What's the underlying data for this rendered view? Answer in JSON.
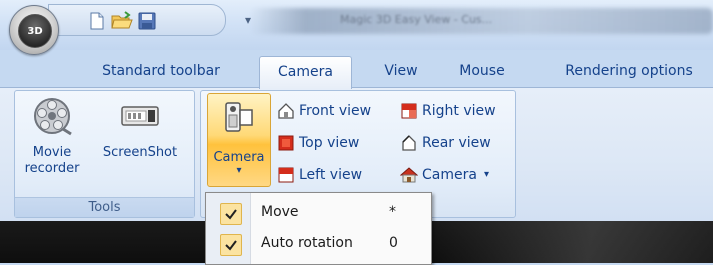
{
  "app": {
    "orb_label": "3D",
    "window_title": "Magic 3D Easy View - Cus..."
  },
  "quick_access": {
    "items": [
      "new-icon",
      "open-icon",
      "save-icon"
    ],
    "customize": "▾"
  },
  "tabs": [
    {
      "label": "Standard toolbar",
      "active": false
    },
    {
      "label": "Camera",
      "active": true
    },
    {
      "label": "View",
      "active": false
    },
    {
      "label": "Mouse",
      "active": false
    },
    {
      "label": "Rendering options",
      "active": false
    }
  ],
  "groups": {
    "tools": {
      "label": "Tools",
      "movie_recorder": {
        "line1": "Movie",
        "line2": "recorder"
      },
      "screenshot": {
        "label": "ScreenShot"
      }
    },
    "camera": {
      "camera_button": {
        "label": "Camera",
        "arrow": "▾"
      },
      "views": [
        {
          "label": "Front view",
          "icon": "front-view-icon"
        },
        {
          "label": "Top view",
          "icon": "top-view-icon"
        },
        {
          "label": "Left view",
          "icon": "left-view-icon"
        },
        {
          "label": "Right view",
          "icon": "right-view-icon"
        },
        {
          "label": "Rear view",
          "icon": "rear-view-icon"
        },
        {
          "label": "Camera",
          "arrow": "▾",
          "icon": "camera-house-icon"
        }
      ]
    }
  },
  "dropdown_menu": {
    "items": [
      {
        "label": "Move",
        "shortcut": "*",
        "checked": true
      },
      {
        "label": "Auto rotation",
        "shortcut": "0",
        "checked": true
      }
    ]
  },
  "colors": {
    "accent_orange": "#ffc23d",
    "ribbon_blue": "#dce7f5",
    "text_blue": "#15428b"
  }
}
